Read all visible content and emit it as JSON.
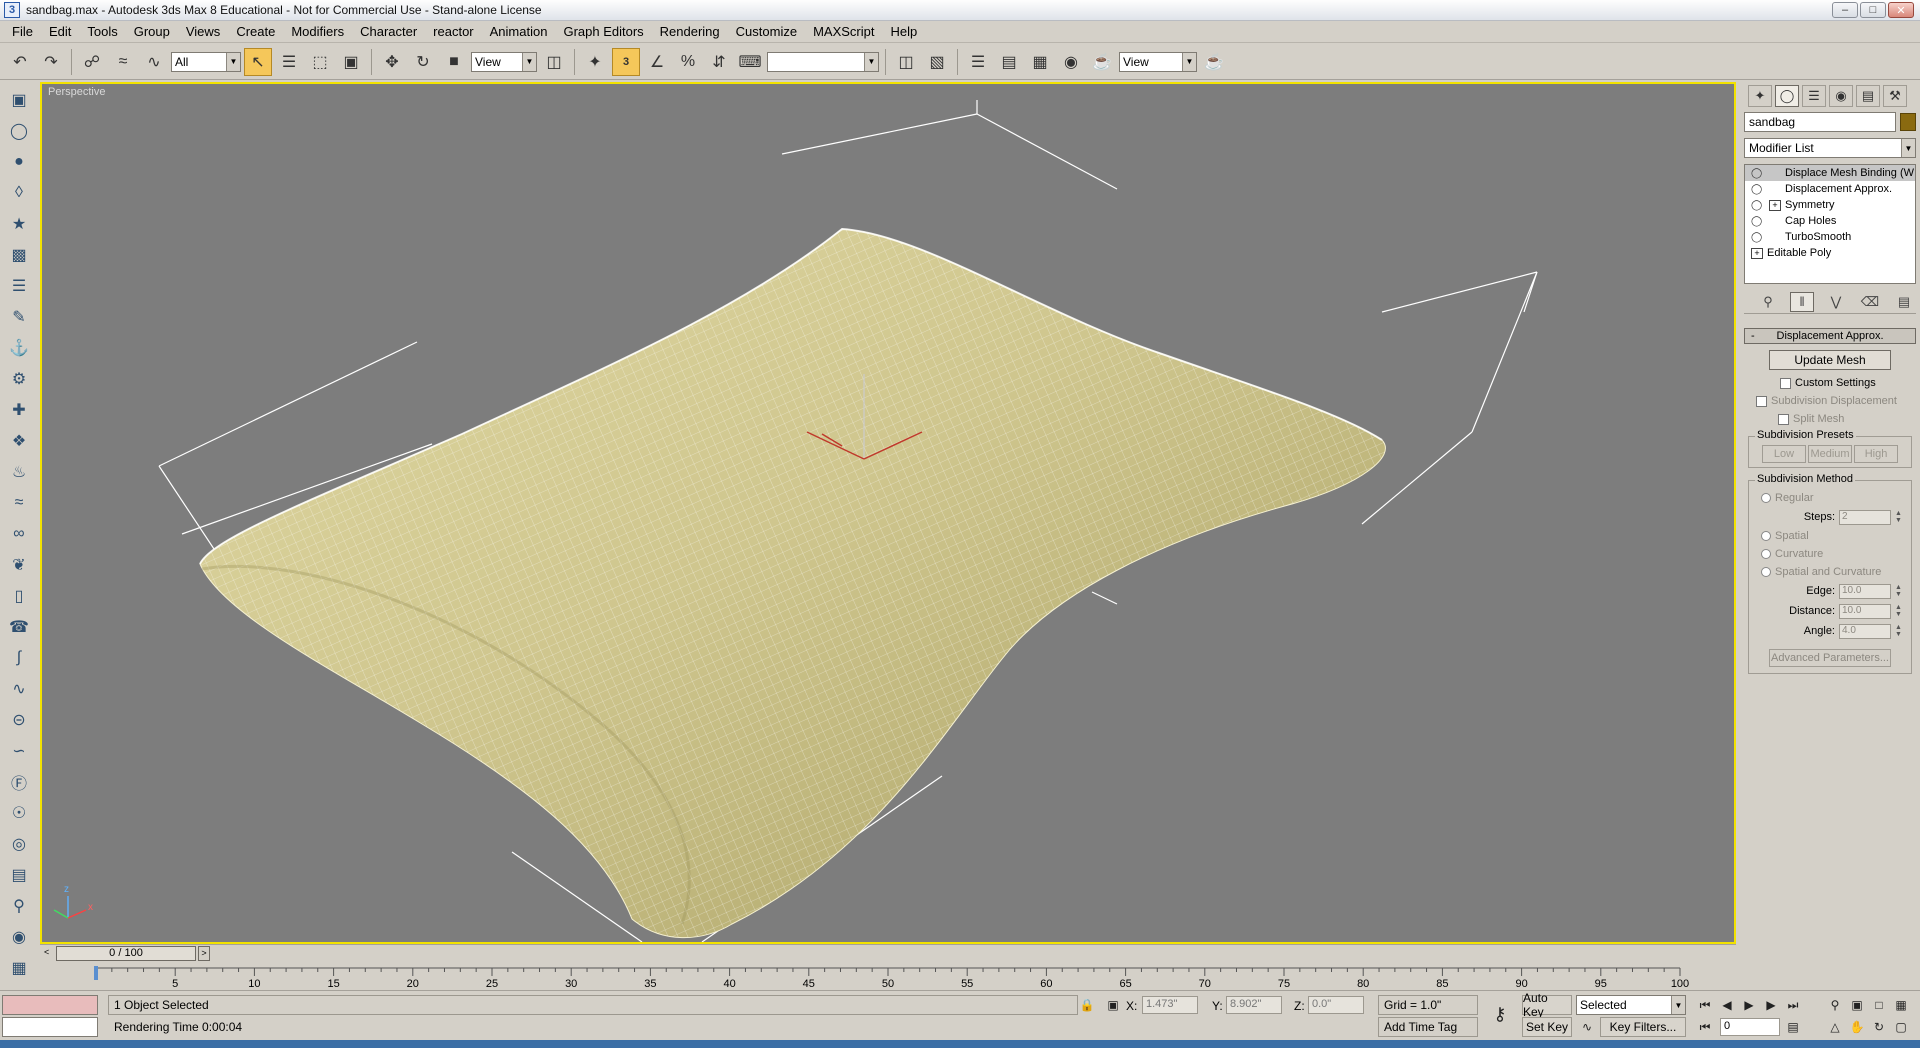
{
  "window": {
    "title": "sandbag.max - Autodesk 3ds Max 8  Educational - Not for Commercial Use - Stand-alone License",
    "icon": "3ds-max-icon",
    "controls": [
      "minimize",
      "maximize",
      "close"
    ]
  },
  "menu": [
    "File",
    "Edit",
    "Tools",
    "Group",
    "Views",
    "Create",
    "Modifiers",
    "Character",
    "reactor",
    "Animation",
    "Graph Editors",
    "Rendering",
    "Customize",
    "MAXScript",
    "Help"
  ],
  "toolbar": {
    "selection_filter": "All",
    "reference_coord": "View",
    "named_selection": "",
    "render_view": "View",
    "snap_label": "3"
  },
  "viewport": {
    "label": "Perspective",
    "active_border_color": "#f2e200",
    "mesh_color": "#cfc68e",
    "background_color": "#7d7d7d"
  },
  "command_panel": {
    "object_name": "sandbag",
    "object_color": "#8a6a10",
    "modifier_list": "Modifier List",
    "stack": [
      {
        "label": "Displace Mesh Binding (W",
        "selected": true,
        "expand": false
      },
      {
        "label": "Displacement Approx.",
        "selected": false,
        "expand": false
      },
      {
        "label": "Symmetry",
        "selected": false,
        "expand": true
      },
      {
        "label": "Cap Holes",
        "selected": false,
        "expand": false
      },
      {
        "label": "TurboSmooth",
        "selected": false,
        "expand": false
      },
      {
        "label": "Editable Poly",
        "selected": false,
        "expand": true,
        "base": true
      }
    ],
    "rollout": {
      "title": "Displacement Approx.",
      "update_mesh": "Update Mesh",
      "custom_settings": "Custom Settings",
      "subdivision_displacement": "Subdivision Displacement",
      "split_mesh": "Split Mesh",
      "presets_title": "Subdivision Presets",
      "presets": [
        "Low",
        "Medium",
        "High"
      ],
      "method_title": "Subdivision Method",
      "regular": "Regular",
      "steps_label": "Steps:",
      "steps_value": "2",
      "spatial": "Spatial",
      "curvature": "Curvature",
      "spatial_curvature": "Spatial and Curvature",
      "edge_label": "Edge:",
      "edge_value": "10.0",
      "distance_label": "Distance:",
      "distance_value": "10.0",
      "angle_label": "Angle:",
      "angle_value": "4.0",
      "advanced": "Advanced Parameters..."
    }
  },
  "timeline": {
    "frame_display": "0 / 100",
    "ticks": [
      5,
      10,
      15,
      20,
      25,
      30,
      35,
      40,
      45,
      50,
      55,
      60,
      65,
      70,
      75,
      80,
      85,
      90,
      95,
      100
    ]
  },
  "status": {
    "selection": "1 Object Selected",
    "render_time": "Rendering Time  0:00:04",
    "x_label": "X:",
    "x_value": "1.473\"",
    "y_label": "Y:",
    "y_value": "8.902\"",
    "z_label": "Z:",
    "z_value": "0.0\"",
    "grid": "Grid = 1.0\"",
    "add_time_tag": "Add Time Tag",
    "auto_key": "Auto Key",
    "set_key": "Set Key",
    "key_mode": "Selected",
    "key_filters": "Key Filters...",
    "current_frame": "0"
  }
}
